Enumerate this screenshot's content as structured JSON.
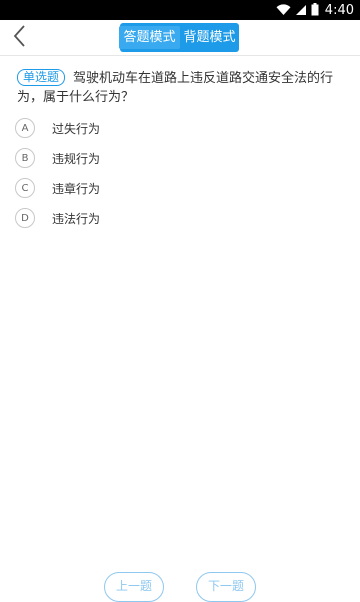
{
  "status_bar": {
    "time": "4:40",
    "icons": [
      "wifi-icon",
      "signal-icon",
      "battery-icon"
    ]
  },
  "header": {
    "modes": [
      {
        "label": "答题模式",
        "active": true
      },
      {
        "label": "背题模式",
        "active": false
      }
    ]
  },
  "question": {
    "type": "单选题",
    "text": "驾驶机动车在道路上违反道路交通安全法的行为，属于什么行为？"
  },
  "options": [
    {
      "letter": "A",
      "text": "过失行为"
    },
    {
      "letter": "B",
      "text": "违规行为"
    },
    {
      "letter": "C",
      "text": "违章行为"
    },
    {
      "letter": "D",
      "text": "违法行为"
    }
  ],
  "bottom_nav": {
    "prev": "上一题",
    "next": "下一题"
  },
  "colors": {
    "accent": "#1e9be8",
    "text": "#333333"
  }
}
